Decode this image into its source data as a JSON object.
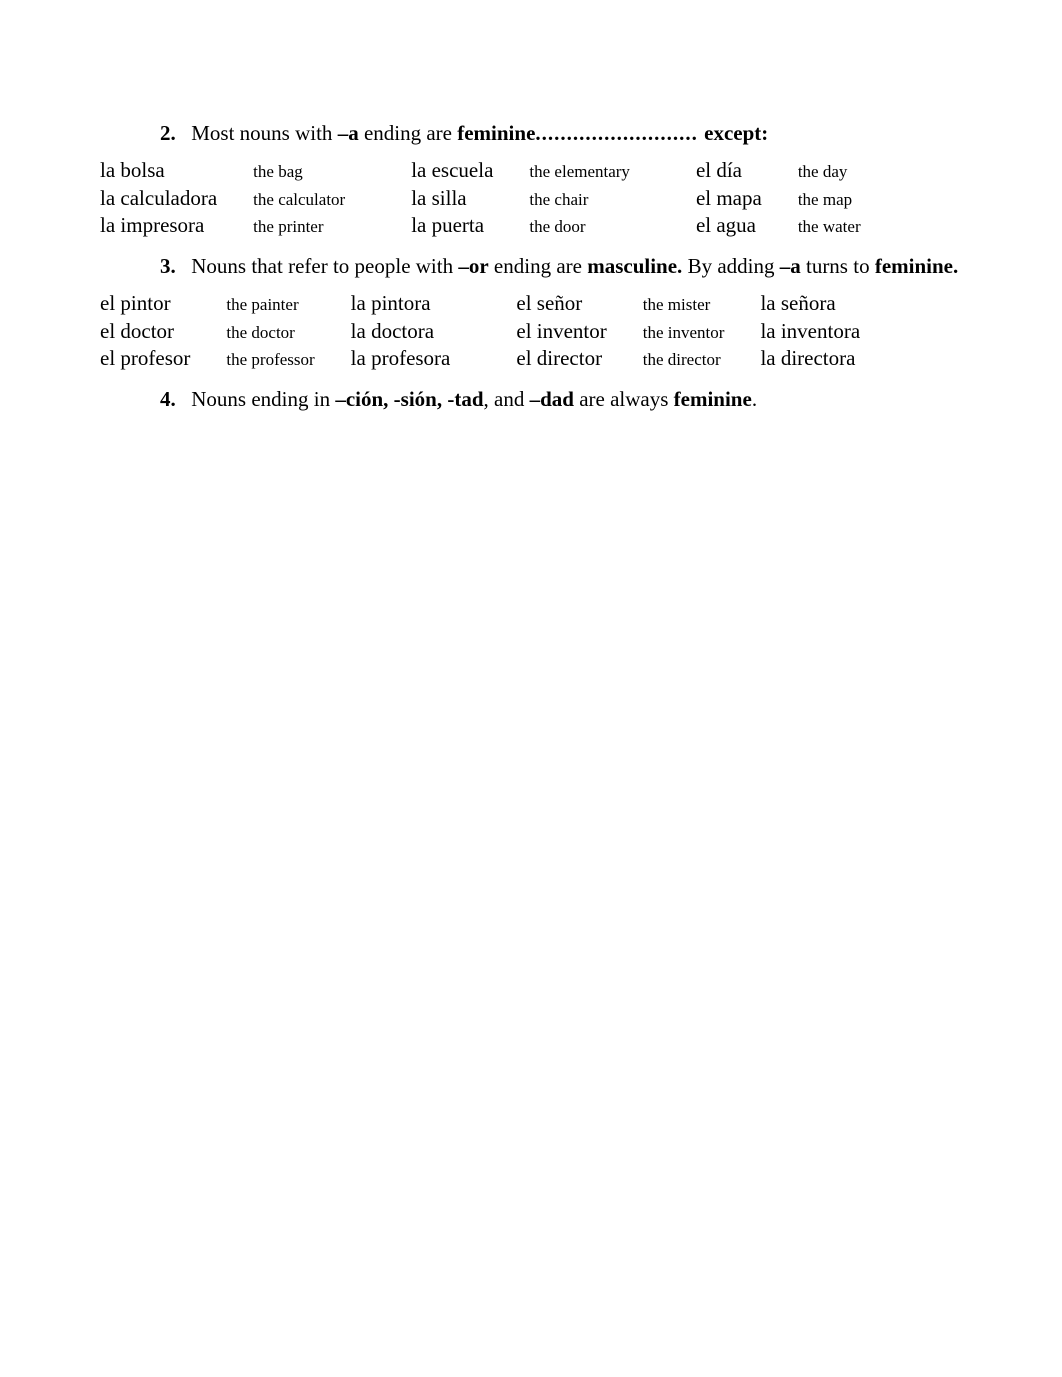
{
  "item2": {
    "num": "2.",
    "text_a": "Most nouns  with ",
    "bold_a": "–a",
    "text_b": " ending are ",
    "bold_b": "feminine",
    "dots": ".......................... ",
    "bold_c": "except:"
  },
  "table1": {
    "r0": {
      "c0": "la bolsa",
      "c1": "the bag",
      "c2": "la escuela",
      "c3": "the elementary",
      "c4": "el día",
      "c5": "the day"
    },
    "r1": {
      "c0": "la calculadora",
      "c1": "the calculator",
      "c2": "la silla",
      "c3": "the chair",
      "c4": "el  mapa",
      "c5": "the map"
    },
    "r2": {
      "c0": "la impresora",
      "c1": "the printer",
      "c2": "la puerta",
      "c3": "the door",
      "c4": "el agua",
      "c5": "the water"
    }
  },
  "item3": {
    "num": "3.",
    "text_a": "Nouns that refer to people with ",
    "bold_a": "–or",
    "text_b": " ending are ",
    "bold_b": "masculine.",
    "text_c": "  By adding ",
    "bold_c": "–a",
    "text_d": " turns to ",
    "bold_d": "feminine."
  },
  "table2": {
    "r0": {
      "c0": "el pintor",
      "c1": "the painter",
      "c2": "la pintora",
      "c3": "el señor",
      "c4": "the mister",
      "c5": "la señora"
    },
    "r1": {
      "c0": "el doctor",
      "c1": "the doctor",
      "c2": "la doctora",
      "c3": "el inventor",
      "c4": "the inventor",
      "c5": "la inventora"
    },
    "r2": {
      "c0": "el profesor",
      "c1": "the professor",
      "c2": "la profesora",
      "c3": "el director",
      "c4": "the director",
      "c5": "la directora"
    }
  },
  "item4": {
    "num": "4.",
    "text_a": "Nouns ending in ",
    "bold_a": "–ción, -sión, -tad",
    "text_b": ", and ",
    "bold_b": "–dad",
    "text_c": " are always ",
    "bold_c": "feminine",
    "text_d": "."
  }
}
